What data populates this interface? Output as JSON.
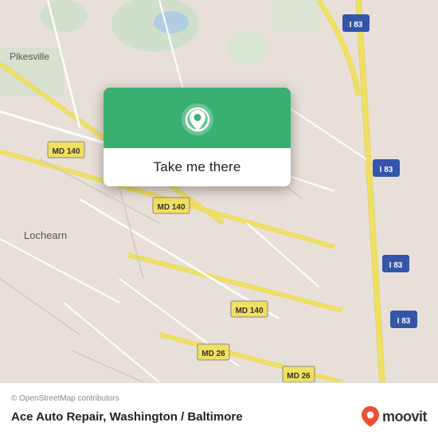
{
  "map": {
    "attribution": "© OpenStreetMap contributors",
    "background_color": "#e8e0d8"
  },
  "popup": {
    "button_label": "Take me there",
    "pin_icon": "location-pin"
  },
  "bottom_bar": {
    "location_title": "Ace Auto Repair, Washington / Baltimore",
    "attribution": "© OpenStreetMap contributors",
    "moovit_text": "moovit"
  }
}
